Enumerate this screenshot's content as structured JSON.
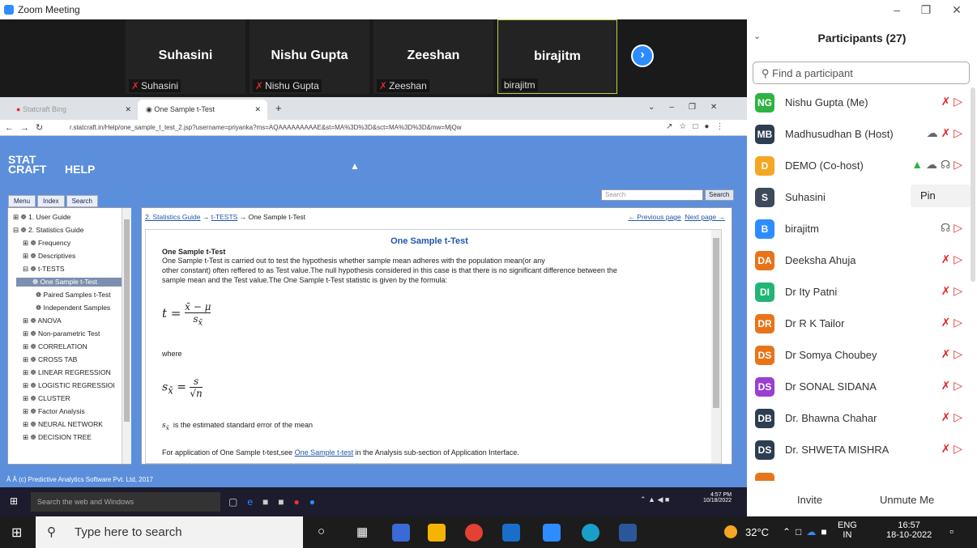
{
  "window": {
    "title": "Zoom Meeting"
  },
  "video_tiles": [
    {
      "name": "Suhasini",
      "label": "Suhasini",
      "muted": true
    },
    {
      "name": "Nishu Gupta",
      "label": "Nishu Gupta",
      "muted": true
    },
    {
      "name": "Zeeshan",
      "label": "Zeeshan",
      "muted": true
    },
    {
      "name": "birajitm",
      "label": "birajitm",
      "muted": false
    }
  ],
  "browser": {
    "tabs": [
      "Statcraft Bing",
      "One Sample t-Test"
    ],
    "url": "r.statcraft.in/Help/one_sample_t_test_2.jsp?username=priyanka?ms=AQAAAAAAAAAE&st=MA%3D%3D&sct=MA%3D%3D&mw=MjQw"
  },
  "help": {
    "logo_top": "STAT",
    "logo_bottom": "CRAFT",
    "title": "HELP",
    "tabs": [
      "Menu",
      "Index",
      "Search"
    ],
    "search_placeholder": "Search",
    "search_button": "Search",
    "tree": [
      "1. User Guide",
      "2. Statistics Guide",
      "Frequency",
      "Descriptives",
      "t-TESTS",
      "One Sample t-Test",
      "Paired Samples t-Test",
      "Independent Samples",
      "ANOVA",
      "Non-parametric Test",
      "CORRELATION",
      "CROSS TAB",
      "LINEAR REGRESSION",
      "LOGISTIC REGRESSIOI",
      "CLUSTER",
      "Factor Analysis",
      "NEURAL NETWORK",
      "DECISION TREE"
    ],
    "breadcrumb": {
      "a": "2. Statistics Guide",
      "b": "t-TESTS",
      "c": "One Sample t-Test"
    },
    "prev": "← Previous page",
    "next": "Next page →",
    "doc": {
      "heading": "One Sample t-Test",
      "subheading": "One Sample t-Test",
      "para1": "One Sample t-Test is carried out to test the hypothesis whether sample mean adheres with the population mean(or any",
      "para2": "other constant) often reffered to as Test value.The null hypothesis considered in this case is that there is no significant difference between the",
      "para3": "sample mean and the Test value.The One Sample t-Test statistic is given by the formula:",
      "where": "where",
      "se_text": "is the estimated standard error of the mean",
      "app_prefix": "For application of One Sample t-test,see",
      "app_link": "One Sample t-test",
      "app_suffix": "in the Analysis sub-section of Application Interface."
    },
    "copyright": "Â Â (c) Predictive Analytics Software Pvt. Ltd, 2017"
  },
  "inner_taskbar": {
    "search": "Search the web and Windows",
    "time": "4:57 PM",
    "date": "10/18/2022"
  },
  "participants": {
    "title": "Participants (27)",
    "find_placeholder": "Find a participant",
    "pin_tooltip": "Pin",
    "list": [
      {
        "initials": "NG",
        "name": "Nishu Gupta (Me)",
        "color": "#2fb344"
      },
      {
        "initials": "MB",
        "name": "Madhusudhan B (Host)",
        "color": "#2c3e50"
      },
      {
        "initials": "D",
        "name": "DEMO (Co-host)",
        "color": "#f5a623"
      },
      {
        "initials": "S",
        "name": "Suhasini",
        "color": "#3d4a5c"
      },
      {
        "initials": "B",
        "name": "birajitm",
        "color": "#2d8cff"
      },
      {
        "initials": "DA",
        "name": "Deeksha Ahuja",
        "color": "#e8741a"
      },
      {
        "initials": "DI",
        "name": "Dr Ity Patni",
        "color": "#22b573"
      },
      {
        "initials": "DR",
        "name": "Dr R K Tailor",
        "color": "#e8741a"
      },
      {
        "initials": "DS",
        "name": "Dr Somya Choubey",
        "color": "#e8741a"
      },
      {
        "initials": "DS",
        "name": "Dr SONAL SIDANA",
        "color": "#9b3fd0"
      },
      {
        "initials": "DB",
        "name": "Dr. Bhawna Chahar",
        "color": "#2c3e50"
      },
      {
        "initials": "DS",
        "name": "Dr. SHWETA MISHRA",
        "color": "#2c3e50"
      }
    ],
    "invite": "Invite",
    "unmute": "Unmute Me"
  },
  "taskbar": {
    "search": "Type here to search",
    "weather": "32°C",
    "lang1": "ENG",
    "lang2": "IN",
    "time": "16:57",
    "date": "18-10-2022"
  }
}
